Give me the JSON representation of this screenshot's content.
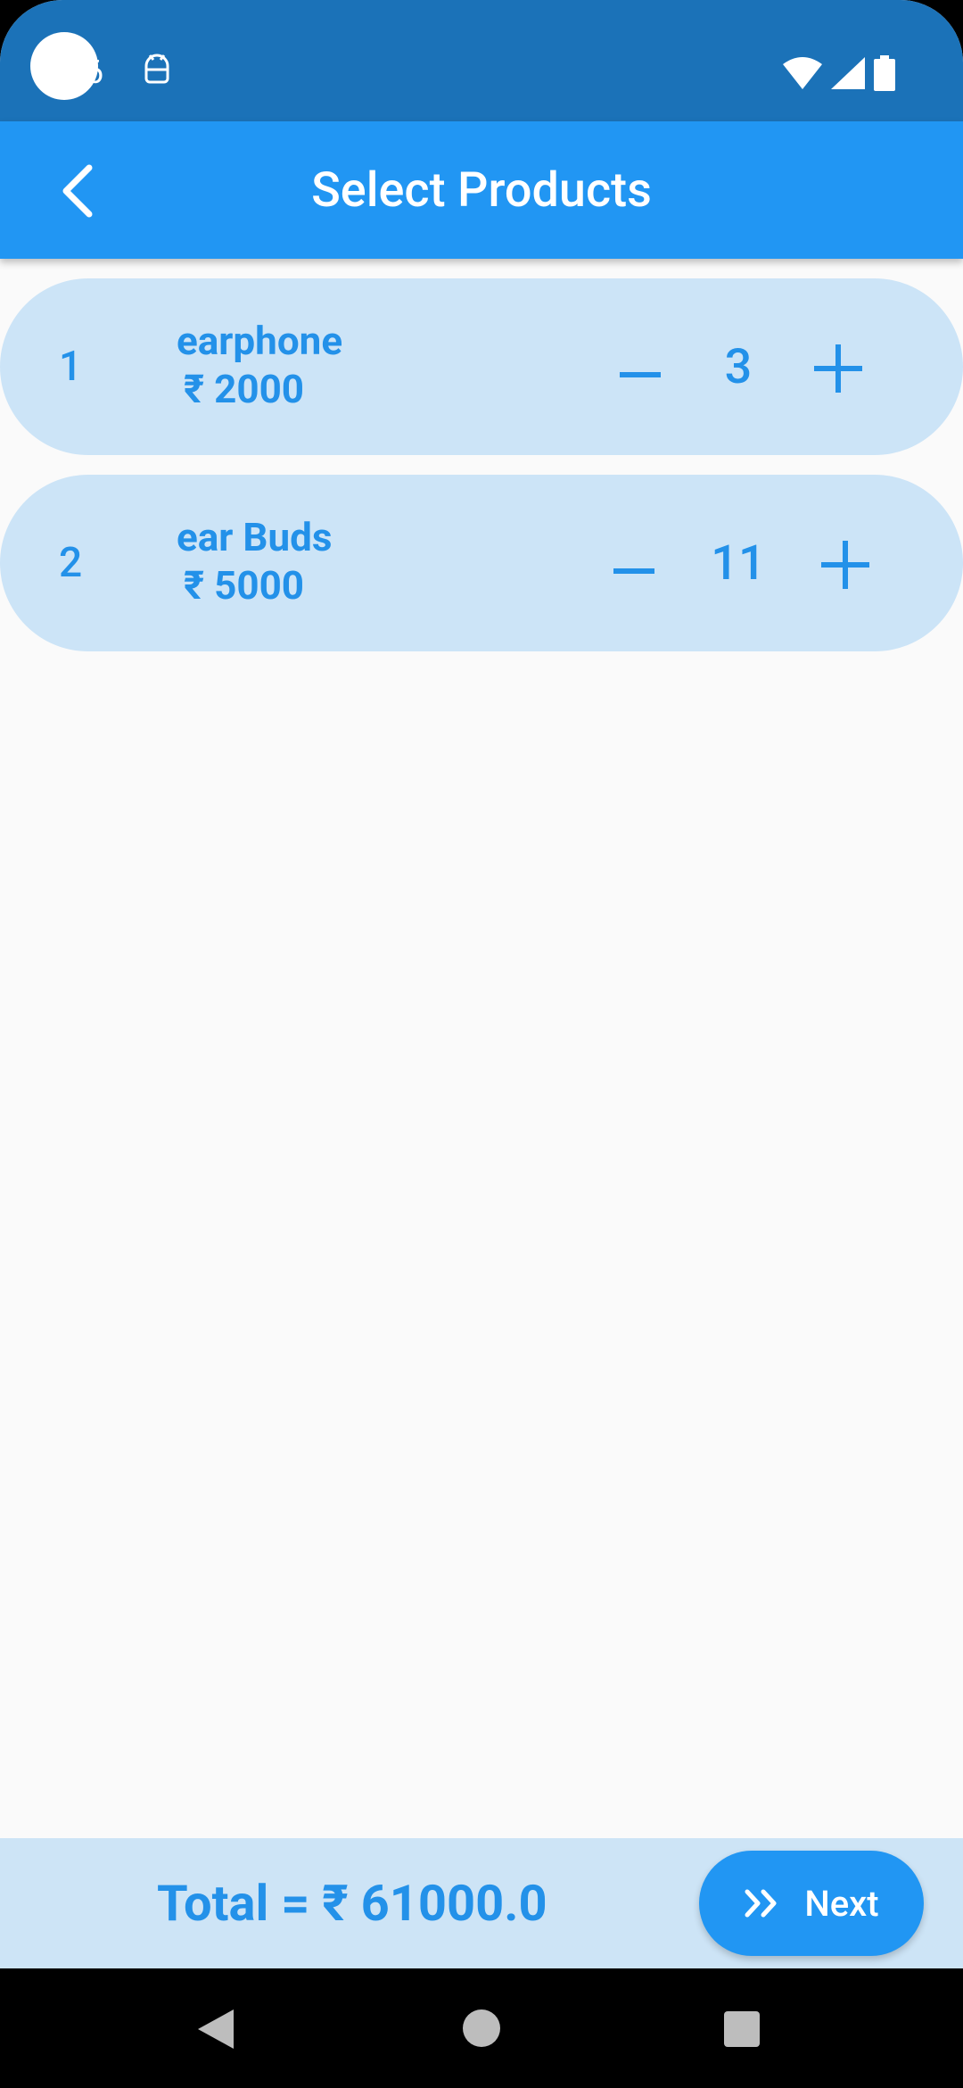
{
  "status_bar": {
    "time": "6",
    "icons": [
      "notification-icon",
      "wifi-icon",
      "signal-icon",
      "battery-icon"
    ]
  },
  "app_bar": {
    "title": "Select Products",
    "back_icon": "back-arrow-icon"
  },
  "products": [
    {
      "index": "1",
      "name": "earphone",
      "price": "₹ 2000",
      "quantity": "3"
    },
    {
      "index": "2",
      "name": "ear Buds",
      "price": "₹ 5000",
      "quantity": "11"
    }
  ],
  "footer": {
    "total": "Total = ₹ 61000.0",
    "next_label": "Next",
    "next_icon": "double-chevron-right-icon"
  },
  "nav_bar": {
    "icons": [
      "nav-back-icon",
      "nav-home-icon",
      "nav-recents-icon"
    ]
  },
  "colors": {
    "status_bar": "#1b72b8",
    "app_bar": "#2196f3",
    "row_background": "#cce4f7",
    "accent_text": "#2391e9",
    "background": "#fafafa"
  }
}
